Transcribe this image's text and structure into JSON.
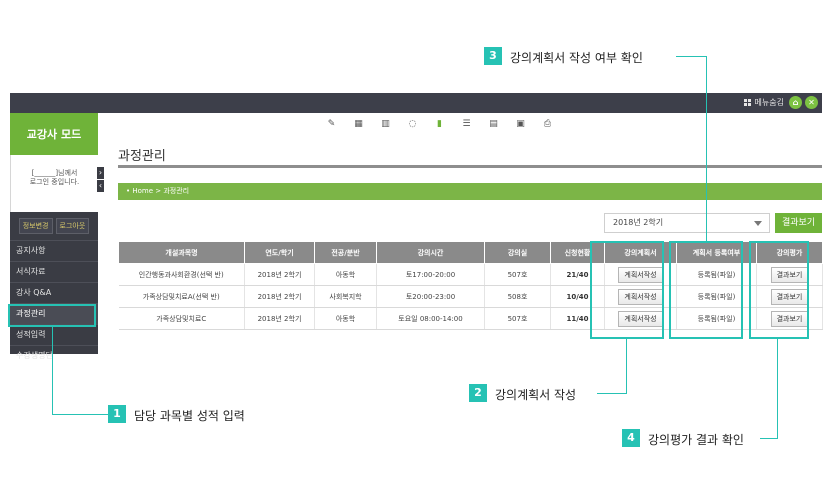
{
  "topbar": {
    "menu_hide": "메뉴숨김"
  },
  "sidebar": {
    "mode_title": "교강사 모드",
    "user_line1": "[______]님께서",
    "user_line2": "로그인 중입니다.",
    "btn_info": "정보변경",
    "btn_logout": "로그아웃",
    "items": [
      {
        "label": "공지사항"
      },
      {
        "label": "서식자료"
      },
      {
        "label": "강사 Q&A"
      },
      {
        "label": "과정관리"
      },
      {
        "label": "성적입력"
      },
      {
        "label": "수강생명단"
      }
    ]
  },
  "main": {
    "page_title": "과정관리",
    "breadcrumb": "•  Home > 과정관리",
    "term_selected": "2018년 2학기",
    "result_btn": "결과보기",
    "table": {
      "headers": [
        "개설과목명",
        "연도/학기",
        "전공/분반",
        "강의시간",
        "강의실",
        "신청현황",
        "강의계획서",
        "계획서 등록여부",
        "강의평가"
      ],
      "rows": [
        {
          "subject": "인간행동과사회환경(선택 반)",
          "term": "2018년 2학기",
          "major": "아동학",
          "time": "토17:00-20:00",
          "room": "507호",
          "status": "21/40",
          "plan_btn": "계획서작성",
          "registered": "등록됨(파일)",
          "eval_btn": "결과보기"
        },
        {
          "subject": "가족상담및치료A(선택 반)",
          "term": "2018년 2학기",
          "major": "사회복지학",
          "time": "토20:00-23:00",
          "room": "508호",
          "status": "10/40",
          "plan_btn": "계획서작성",
          "registered": "등록됨(파일)",
          "eval_btn": "결과보기"
        },
        {
          "subject": "가족상담및치료C",
          "term": "2018년 2학기",
          "major": "아동학",
          "time": "토요일 08:00-14:00",
          "room": "507호",
          "status": "11/40",
          "plan_btn": "계획서작성",
          "registered": "등록됨(파일)",
          "eval_btn": "결과보기"
        }
      ]
    }
  },
  "callouts": {
    "c1": {
      "num": "1",
      "text": "담당 과목별 성적 입력"
    },
    "c2": {
      "num": "2",
      "text": "강의계획서 작성"
    },
    "c3": {
      "num": "3",
      "text": "강의계획서 작성 여부 확인"
    },
    "c4": {
      "num": "4",
      "text": "강의평가 결과 확인"
    }
  },
  "colors": {
    "accent": "#6fb339",
    "callout": "#26c2b4",
    "topbar": "#3d3f4a",
    "sidebar": "#3a3c44"
  }
}
